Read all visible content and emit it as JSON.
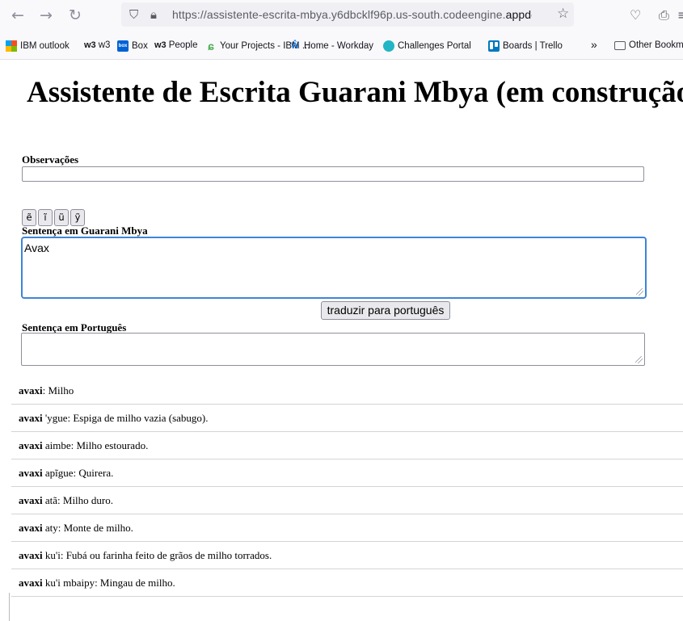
{
  "browser": {
    "url_host_prefix": "https://assistente-escrita-mbya.y6dbcklf96p.us-south.codeengine.",
    "url_host_bold": "appdomain.c",
    "bookmarks": [
      {
        "label": "IBM outlook",
        "icon": "microsoft-icon"
      },
      {
        "label": "w3",
        "prefix": "w3",
        "icon": "w3-icon"
      },
      {
        "label": "Box",
        "icon": "box-icon"
      },
      {
        "label": "People",
        "prefix": "w3",
        "icon": "w3-icon"
      },
      {
        "label": "Your Projects - IBM ...",
        "icon": "leaf-icon"
      },
      {
        "label": "Home - Workday",
        "icon": "workday-icon"
      },
      {
        "label": "Challenges Portal",
        "icon": "challenges-icon"
      },
      {
        "label": "Boards | Trello",
        "icon": "trello-icon"
      },
      {
        "label": "Other Bookmar",
        "icon": "folder-icon"
      }
    ],
    "overflow_chevron": "»"
  },
  "page": {
    "title": "Assistente de Escrita Guarani Mbya (em construção)",
    "observations_label": "Observações",
    "observations_value": "",
    "special_chars": [
      "ẽ",
      "ĩ",
      "ũ",
      "ỹ"
    ],
    "mbya_label": "Sentença em Guarani Mbya",
    "mbya_value": "Avax",
    "translate_button": "traduzir para português",
    "portuguese_label": "Sentença em Português",
    "portuguese_value": ""
  },
  "results": [
    {
      "term": "avaxi",
      "rest": ": Milho"
    },
    {
      "term": "avaxi",
      "rest": " 'ygue: Espiga de milho vazia (sabugo)."
    },
    {
      "term": "avaxi",
      "rest": " aimbe: Milho estourado."
    },
    {
      "term": "avaxi",
      "rest": " apĩgue: Quirera."
    },
    {
      "term": "avaxi",
      "rest": " atã: Milho duro."
    },
    {
      "term": "avaxi",
      "rest": " aty: Monte de milho."
    },
    {
      "term": "avaxi",
      "rest": " ku'i: Fubá ou farinha feito de grãos de milho torrados."
    },
    {
      "term": "avaxi",
      "rest": " ku'i mbaipy: Mingau de milho."
    }
  ]
}
